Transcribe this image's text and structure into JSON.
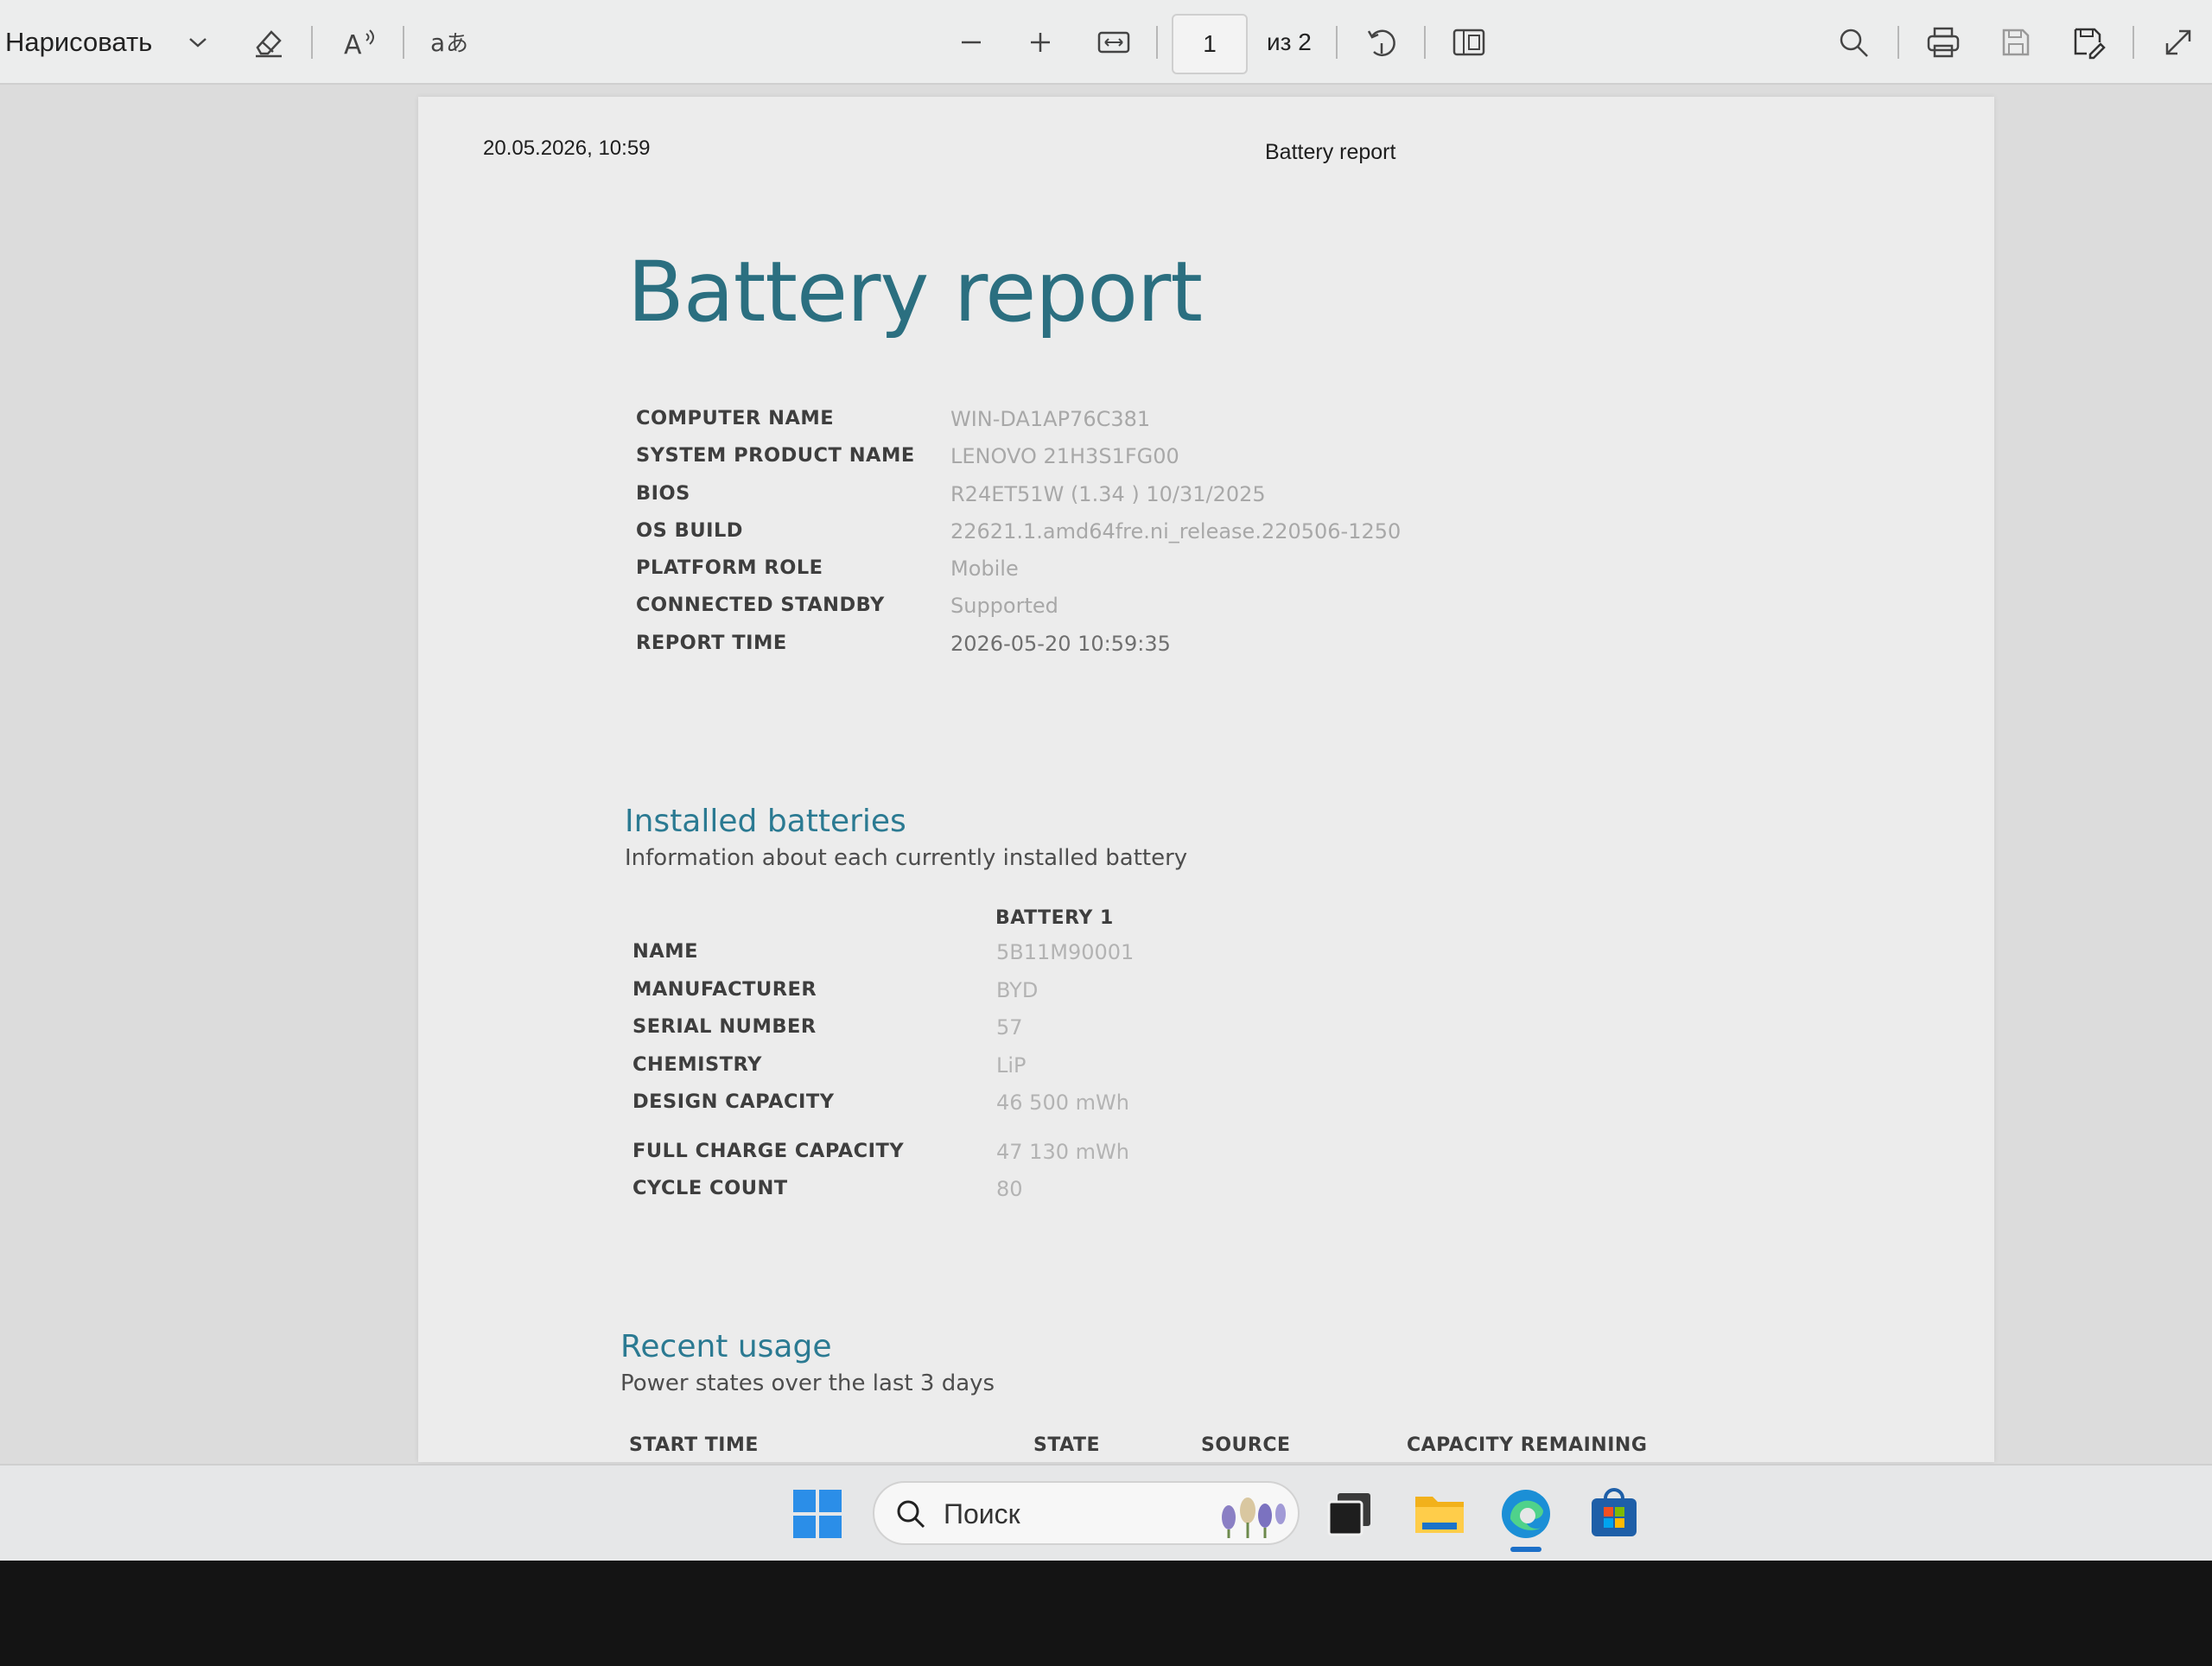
{
  "toolbar": {
    "draw_label": "Нарисовать",
    "page_current": "1",
    "page_total_label": "из 2"
  },
  "page_header": {
    "date_time": "20.05.2026, 10:59",
    "title": "Battery report"
  },
  "report": {
    "title": "Battery report",
    "system_info": [
      {
        "label": "COMPUTER NAME",
        "value": "WIN-DA1AP76C381"
      },
      {
        "label": "SYSTEM PRODUCT NAME",
        "value": "LENOVO 21H3S1FG00"
      },
      {
        "label": "BIOS",
        "value": "R24ET51W (1.34 ) 10/31/2025"
      },
      {
        "label": "OS BUILD",
        "value": "22621.1.amd64fre.ni_release.220506-1250"
      },
      {
        "label": "PLATFORM ROLE",
        "value": "Mobile"
      },
      {
        "label": "CONNECTED STANDBY",
        "value": "Supported"
      },
      {
        "label": "REPORT TIME",
        "value": "2026-05-20  10:59:35"
      }
    ]
  },
  "installed_batteries": {
    "title": "Installed batteries",
    "subtitle": "Information about each currently installed battery",
    "column_header": "BATTERY 1",
    "rows": [
      {
        "label": "NAME",
        "value": "5B11M90001"
      },
      {
        "label": "MANUFACTURER",
        "value": "BYD"
      },
      {
        "label": "SERIAL NUMBER",
        "value": "57"
      },
      {
        "label": "CHEMISTRY",
        "value": "LiP"
      },
      {
        "label": "DESIGN CAPACITY",
        "value": "46 500 mWh"
      },
      {
        "label": "FULL CHARGE CAPACITY",
        "value": "47 130 mWh"
      },
      {
        "label": "CYCLE COUNT",
        "value": "80"
      }
    ]
  },
  "recent_usage": {
    "title": "Recent usage",
    "subtitle": "Power states over the last 3 days",
    "columns": [
      "START TIME",
      "STATE",
      "SOURCE",
      "CAPACITY REMAINING"
    ]
  },
  "taskbar": {
    "search_placeholder": "Поиск",
    "accent_color": "#1b6fc8"
  }
}
